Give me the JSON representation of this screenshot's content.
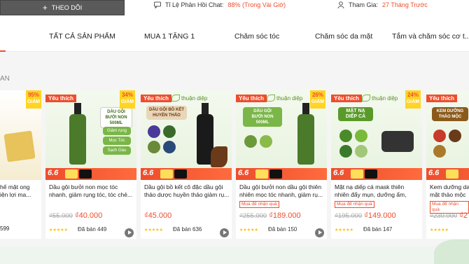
{
  "header": {
    "follow_label": "THEO DÕI",
    "chat_label": "Tỉ Lệ Phản Hồi Chat:",
    "chat_value": "88% (Trong Vài Giờ)",
    "joined_label": "Tham Gia:",
    "joined_value": "27 Tháng Trước"
  },
  "tabs": [
    {
      "label": "TẤT CẢ SẢN PHẨM"
    },
    {
      "label": "MUA 1 TẶNG 1"
    },
    {
      "label": "Chăm sóc tóc"
    },
    {
      "label": "Chăm sóc da mặt"
    },
    {
      "label": "Tắm và chăm sóc cơ t..."
    }
  ],
  "tab_partial": "",
  "section_label": "AN",
  "brand": "thuận diệp",
  "promo_date": "6.6",
  "colors": {
    "accent": "#ee4d2d",
    "gold": "#ffd424",
    "brand_green": "#7ab648"
  },
  "left_partial": {
    "discount_pct": "95%",
    "discount_word": "GIẢM",
    "line1": "hế mật ong",
    "line2": "iện lợi ma...",
    "sold": "599"
  },
  "products": [
    {
      "fav": "Yêu thích",
      "discount_pct": "34%",
      "discount_word": "GIẢM",
      "title": "Dầu gội bưởi non mọc tóc nhanh, giảm rụng tóc, tóc chẻ...",
      "gift": "",
      "old_price": "₫55.000",
      "price": "₫40.000",
      "stars": "★★★★★",
      "sold": "Đã bán 449",
      "tags": [
        "DẦU GỘI BƯỞI NON",
        "500ML",
        "Giảm rụng",
        "Mọc Tóc",
        "Sạch Gàu"
      ]
    },
    {
      "fav": "Yêu thích",
      "discount_pct": "",
      "discount_word": "",
      "title": "Dầu gội bồ kết cô đặc dầu gội thảo dược huyền thảo giảm rụ...",
      "gift": "",
      "old_price": "",
      "price": "₫45.000",
      "stars": "★★★★★",
      "sold": "Đã bán 636",
      "tags": [
        "DẦU GỘI BỒ KẾT",
        "HUYỀN THẢO"
      ]
    },
    {
      "fav": "Yêu thích",
      "discount_pct": "26%",
      "discount_word": "GIẢM",
      "title": "Dầu gội bưởi non dầu gội thiên nhiên mọc tóc nhanh, giảm rụ...",
      "gift": "Mua để nhận quà",
      "old_price": "₫255.000",
      "price": "₫189.000",
      "stars": "★★★★★",
      "sold": "Đã bán 150",
      "tags": [
        "DẦU GỘI",
        "BƯỞI NON",
        "500ML"
      ]
    },
    {
      "fav": "Yêu thích",
      "discount_pct": "24%",
      "discount_word": "GIẢM",
      "title": "Mặt nạ diếp cá mask thiên nhiên đẩy mụn, dưỡng ẩm, sáng da...",
      "gift": "Mua để nhận quà",
      "old_price": "₫195.000",
      "price": "₫149.000",
      "stars": "★★★★★",
      "sold": "Đã bán 147",
      "tags": [
        "MẶT NẠ",
        "DIẾP CÁ"
      ]
    },
    {
      "fav": "Yêu thích",
      "discount_pct": "",
      "discount_word": "",
      "title": "Kem dưỡng da mặt thảo mộc",
      "gift": "Mua để nhận quà",
      "old_price": "₫230.000",
      "price": "₫2",
      "stars": "★★★★★",
      "sold": "",
      "tags": [
        "KEM DƯỠNG",
        "THẢO MỘC"
      ]
    }
  ]
}
